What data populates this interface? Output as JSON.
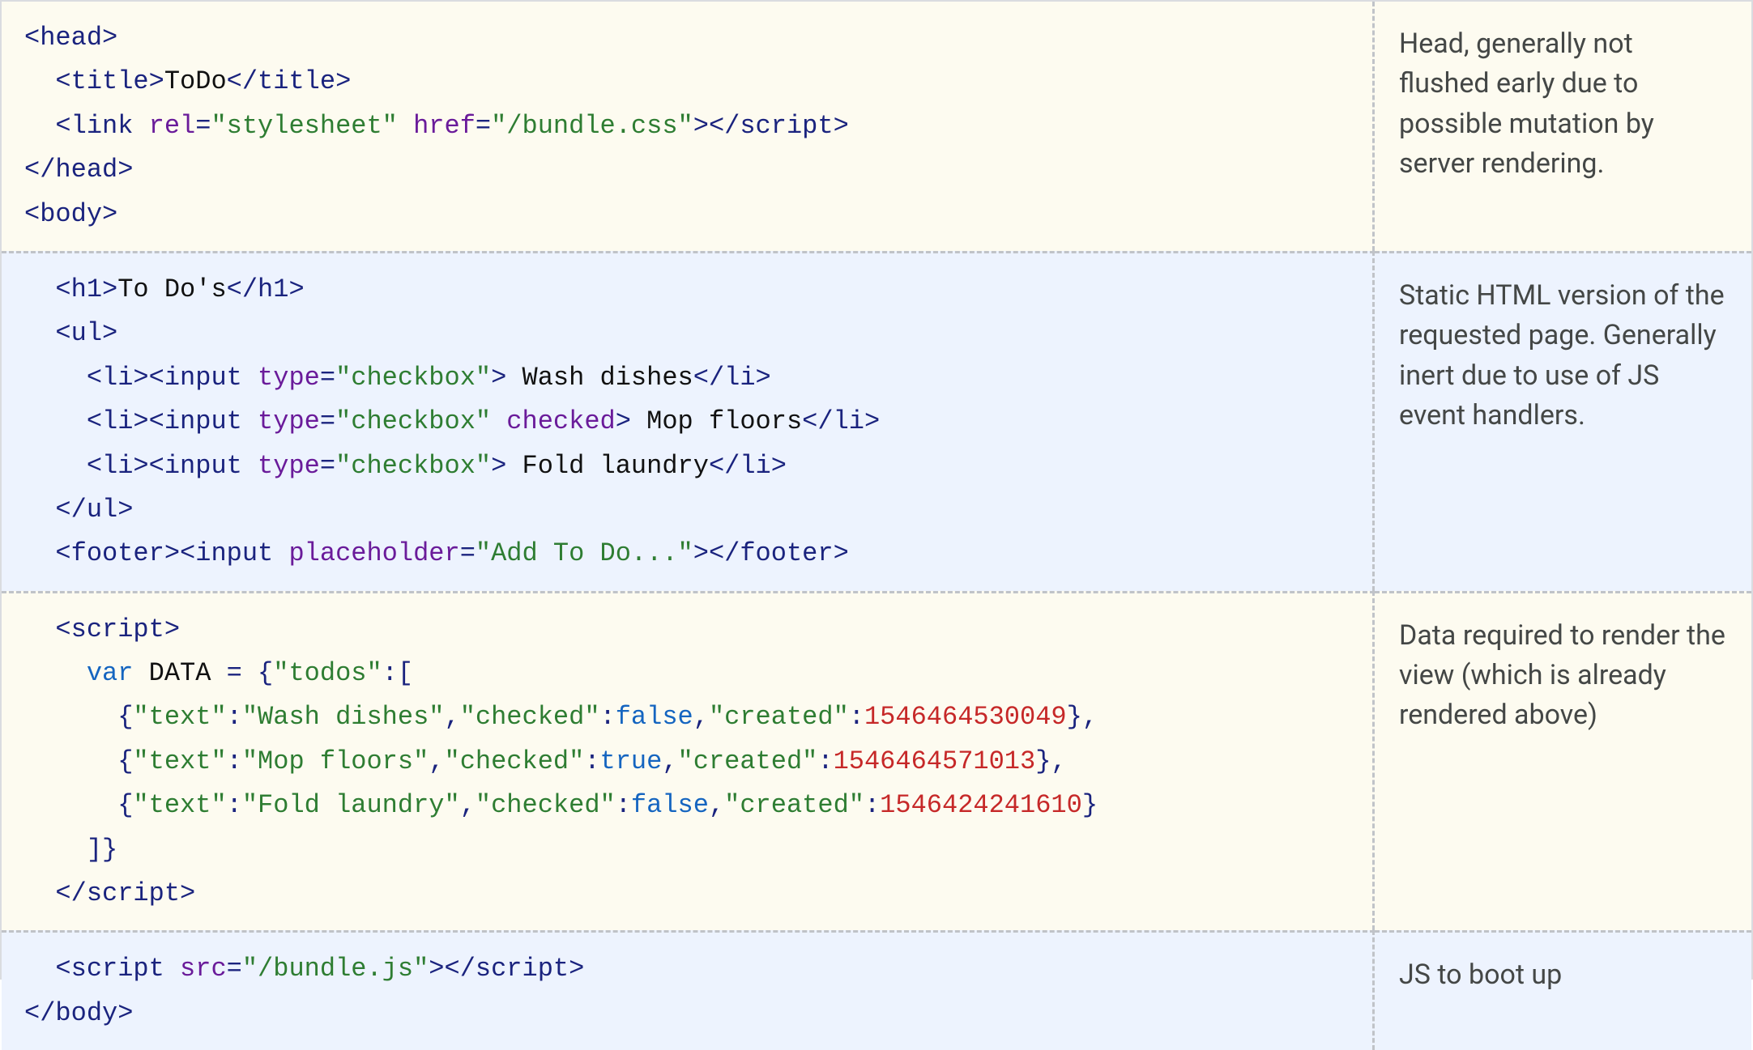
{
  "sections": [
    {
      "bg": "cream",
      "annotation": "Head, generally not flushed early due to possible mutation by server rendering.",
      "lines": [
        [
          {
            "t": "tag",
            "v": "<head>"
          }
        ],
        [
          {
            "t": "text",
            "v": "  "
          },
          {
            "t": "tag",
            "v": "<title>"
          },
          {
            "t": "text",
            "v": "ToDo"
          },
          {
            "t": "tag",
            "v": "</title>"
          }
        ],
        [
          {
            "t": "text",
            "v": "  "
          },
          {
            "t": "tag",
            "v": "<link"
          },
          {
            "t": "text",
            "v": " "
          },
          {
            "t": "attr",
            "v": "rel"
          },
          {
            "t": "tag",
            "v": "="
          },
          {
            "t": "str",
            "v": "\"stylesheet\""
          },
          {
            "t": "text",
            "v": " "
          },
          {
            "t": "attr",
            "v": "href"
          },
          {
            "t": "tag",
            "v": "="
          },
          {
            "t": "str",
            "v": "\"/bundle.css\""
          },
          {
            "t": "tag",
            "v": ">"
          },
          {
            "t": "tag",
            "v": "</script"
          },
          {
            "t": "tag",
            "v": ">"
          }
        ],
        [
          {
            "t": "tag",
            "v": "</head>"
          }
        ],
        [
          {
            "t": "tag",
            "v": "<body>"
          }
        ]
      ]
    },
    {
      "bg": "blue",
      "annotation": "Static HTML version of the requested page. Generally inert due to use of JS event handlers.",
      "lines": [
        [
          {
            "t": "text",
            "v": "  "
          },
          {
            "t": "tag",
            "v": "<h1>"
          },
          {
            "t": "text",
            "v": "To Do's"
          },
          {
            "t": "tag",
            "v": "</h1>"
          }
        ],
        [
          {
            "t": "text",
            "v": "  "
          },
          {
            "t": "tag",
            "v": "<ul>"
          }
        ],
        [
          {
            "t": "text",
            "v": "    "
          },
          {
            "t": "tag",
            "v": "<li><input"
          },
          {
            "t": "text",
            "v": " "
          },
          {
            "t": "attr",
            "v": "type"
          },
          {
            "t": "tag",
            "v": "="
          },
          {
            "t": "str",
            "v": "\"checkbox\""
          },
          {
            "t": "tag",
            "v": ">"
          },
          {
            "t": "text",
            "v": " Wash dishes"
          },
          {
            "t": "tag",
            "v": "</li>"
          }
        ],
        [
          {
            "t": "text",
            "v": "    "
          },
          {
            "t": "tag",
            "v": "<li><input"
          },
          {
            "t": "text",
            "v": " "
          },
          {
            "t": "attr",
            "v": "type"
          },
          {
            "t": "tag",
            "v": "="
          },
          {
            "t": "str",
            "v": "\"checkbox\""
          },
          {
            "t": "text",
            "v": " "
          },
          {
            "t": "attr",
            "v": "checked"
          },
          {
            "t": "tag",
            "v": ">"
          },
          {
            "t": "text",
            "v": " Mop floors"
          },
          {
            "t": "tag",
            "v": "</li>"
          }
        ],
        [
          {
            "t": "text",
            "v": "    "
          },
          {
            "t": "tag",
            "v": "<li><input"
          },
          {
            "t": "text",
            "v": " "
          },
          {
            "t": "attr",
            "v": "type"
          },
          {
            "t": "tag",
            "v": "="
          },
          {
            "t": "str",
            "v": "\"checkbox\""
          },
          {
            "t": "tag",
            "v": ">"
          },
          {
            "t": "text",
            "v": " Fold laundry"
          },
          {
            "t": "tag",
            "v": "</li>"
          }
        ],
        [
          {
            "t": "text",
            "v": "  "
          },
          {
            "t": "tag",
            "v": "</ul>"
          }
        ],
        [
          {
            "t": "text",
            "v": "  "
          },
          {
            "t": "tag",
            "v": "<footer><input"
          },
          {
            "t": "text",
            "v": " "
          },
          {
            "t": "attr",
            "v": "placeholder"
          },
          {
            "t": "tag",
            "v": "="
          },
          {
            "t": "str",
            "v": "\"Add To Do...\""
          },
          {
            "t": "tag",
            "v": ">"
          },
          {
            "t": "tag",
            "v": "</footer>"
          }
        ]
      ]
    },
    {
      "bg": "cream",
      "annotation": "Data required to render the view (which is already rendered above)",
      "lines": [
        [
          {
            "t": "text",
            "v": "  "
          },
          {
            "t": "tag",
            "v": "<script>"
          }
        ],
        [
          {
            "t": "text",
            "v": "    "
          },
          {
            "t": "kw",
            "v": "var"
          },
          {
            "t": "text",
            "v": " DATA "
          },
          {
            "t": "tag",
            "v": "="
          },
          {
            "t": "text",
            "v": " "
          },
          {
            "t": "tag",
            "v": "{"
          },
          {
            "t": "str",
            "v": "\"todos\""
          },
          {
            "t": "tag",
            "v": ":["
          }
        ],
        [
          {
            "t": "text",
            "v": "      "
          },
          {
            "t": "tag",
            "v": "{"
          },
          {
            "t": "str",
            "v": "\"text\""
          },
          {
            "t": "tag",
            "v": ":"
          },
          {
            "t": "str",
            "v": "\"Wash dishes\""
          },
          {
            "t": "tag",
            "v": ","
          },
          {
            "t": "str",
            "v": "\"checked\""
          },
          {
            "t": "tag",
            "v": ":"
          },
          {
            "t": "bool",
            "v": "false"
          },
          {
            "t": "tag",
            "v": ","
          },
          {
            "t": "str",
            "v": "\"created\""
          },
          {
            "t": "tag",
            "v": ":"
          },
          {
            "t": "num",
            "v": "1546464530049"
          },
          {
            "t": "tag",
            "v": "},"
          }
        ],
        [
          {
            "t": "text",
            "v": "      "
          },
          {
            "t": "tag",
            "v": "{"
          },
          {
            "t": "str",
            "v": "\"text\""
          },
          {
            "t": "tag",
            "v": ":"
          },
          {
            "t": "str",
            "v": "\"Mop floors\""
          },
          {
            "t": "tag",
            "v": ","
          },
          {
            "t": "str",
            "v": "\"checked\""
          },
          {
            "t": "tag",
            "v": ":"
          },
          {
            "t": "bool",
            "v": "true"
          },
          {
            "t": "tag",
            "v": ","
          },
          {
            "t": "str",
            "v": "\"created\""
          },
          {
            "t": "tag",
            "v": ":"
          },
          {
            "t": "num",
            "v": "1546464571013"
          },
          {
            "t": "tag",
            "v": "},"
          }
        ],
        [
          {
            "t": "text",
            "v": "      "
          },
          {
            "t": "tag",
            "v": "{"
          },
          {
            "t": "str",
            "v": "\"text\""
          },
          {
            "t": "tag",
            "v": ":"
          },
          {
            "t": "str",
            "v": "\"Fold laundry\""
          },
          {
            "t": "tag",
            "v": ","
          },
          {
            "t": "str",
            "v": "\"checked\""
          },
          {
            "t": "tag",
            "v": ":"
          },
          {
            "t": "bool",
            "v": "false"
          },
          {
            "t": "tag",
            "v": ","
          },
          {
            "t": "str",
            "v": "\"created\""
          },
          {
            "t": "tag",
            "v": ":"
          },
          {
            "t": "num",
            "v": "1546424241610"
          },
          {
            "t": "tag",
            "v": "}"
          }
        ],
        [
          {
            "t": "text",
            "v": "    "
          },
          {
            "t": "tag",
            "v": "]}"
          }
        ],
        [
          {
            "t": "text",
            "v": "  "
          },
          {
            "t": "tag",
            "v": "</scr"
          },
          {
            "t": "tag",
            "v": "ipt>"
          }
        ]
      ]
    },
    {
      "bg": "blue",
      "annotation": "JS to boot up",
      "lines": [
        [
          {
            "t": "text",
            "v": "  "
          },
          {
            "t": "tag",
            "v": "<script"
          },
          {
            "t": "text",
            "v": " "
          },
          {
            "t": "attr",
            "v": "src"
          },
          {
            "t": "tag",
            "v": "="
          },
          {
            "t": "str",
            "v": "\"/bundle.js\""
          },
          {
            "t": "tag",
            "v": ">"
          },
          {
            "t": "tag",
            "v": "</scr"
          },
          {
            "t": "tag",
            "v": "ipt>"
          }
        ],
        [
          {
            "t": "tag",
            "v": "</body>"
          }
        ]
      ]
    }
  ]
}
